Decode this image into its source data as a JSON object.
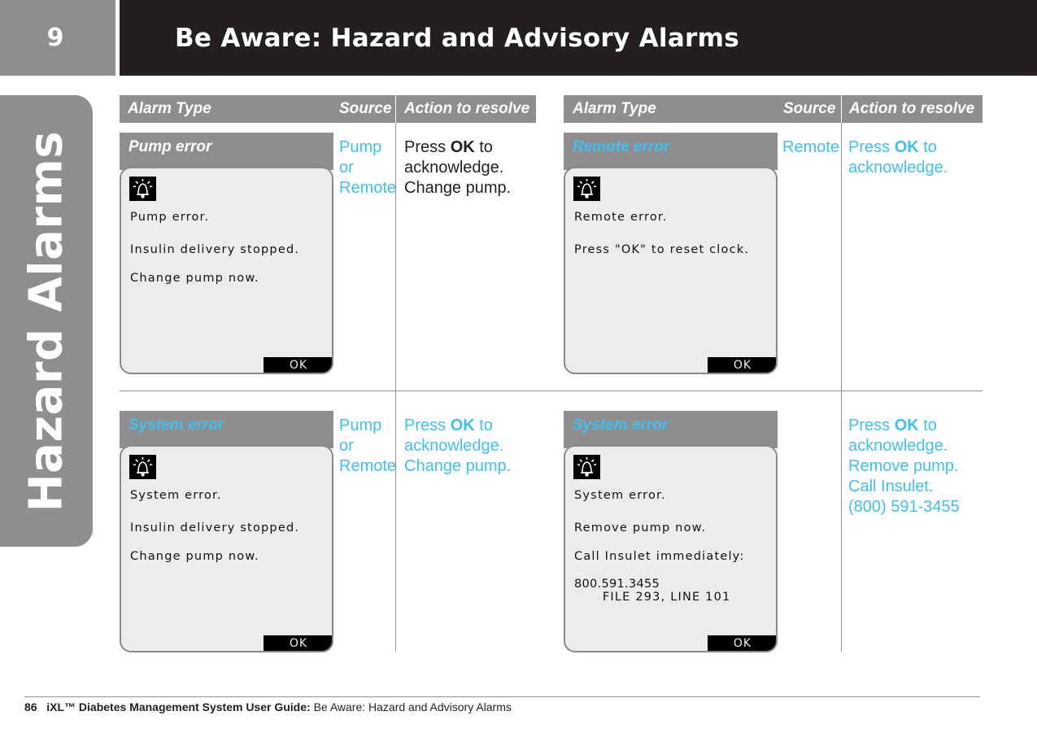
{
  "header": {
    "chapter_number": "9",
    "title": "Be Aware: Hazard and Advisory Alarms"
  },
  "side_tab": {
    "label": "Hazard Alarms"
  },
  "columns": {
    "alarm_type": "Alarm Type",
    "source": "Source",
    "action": "Action to resolve"
  },
  "alarms": [
    {
      "type": "Pump error",
      "source": [
        "Pump",
        "or",
        "Remote"
      ],
      "action": {
        "prefix": "Press ",
        "bold": "OK",
        "suffix": " to",
        "lines": [
          "acknowledge.",
          "Change pump."
        ]
      },
      "screen": {
        "icon": "alarm-bell-icon",
        "lines": [
          "Pump error.",
          "Insulin delivery stopped.",
          "Change pump now."
        ],
        "ok_label": "OK"
      }
    },
    {
      "type": "Remote error",
      "source": [
        "Remote"
      ],
      "action": {
        "prefix": "Press ",
        "bold": "OK",
        "suffix": " to",
        "lines": [
          "acknowledge."
        ]
      },
      "screen": {
        "icon": "alarm-bell-icon",
        "lines": [
          "Remote error.",
          "Press \"OK\" to reset clock."
        ],
        "ok_label": "OK"
      }
    },
    {
      "type": "System error",
      "source": [
        "Pump",
        "or",
        "Remote"
      ],
      "action": {
        "prefix": "Press ",
        "bold": "OK",
        "suffix": " to",
        "lines": [
          "acknowledge.",
          "Change pump."
        ]
      },
      "screen": {
        "icon": "alarm-bell-icon",
        "lines": [
          "System error.",
          "Insulin delivery stopped.",
          "Change pump now."
        ],
        "ok_label": "OK"
      }
    },
    {
      "type": "System error",
      "source": [],
      "action": {
        "prefix": "Press ",
        "bold": "OK",
        "suffix": " to",
        "lines": [
          "acknowledge.",
          "Remove pump.",
          "Call Insulet.",
          "(800) 591-3455"
        ]
      },
      "screen": {
        "icon": "alarm-bell-icon",
        "lines": [
          "System error.",
          "Remove pump now.",
          "Call Insulet immediately:",
          "800.591.3455",
          "      FILE 293, LINE 101"
        ],
        "ok_label": "OK"
      }
    }
  ],
  "footer": {
    "page_number": "86",
    "guide_title": "iXL™ Diabetes Management System User Guide:",
    "section": "Be Aware: Hazard and Advisory Alarms"
  },
  "colors": {
    "gray": "#8f8d8e",
    "dark": "#231f20",
    "accent_blue": "#3fc0ee"
  }
}
